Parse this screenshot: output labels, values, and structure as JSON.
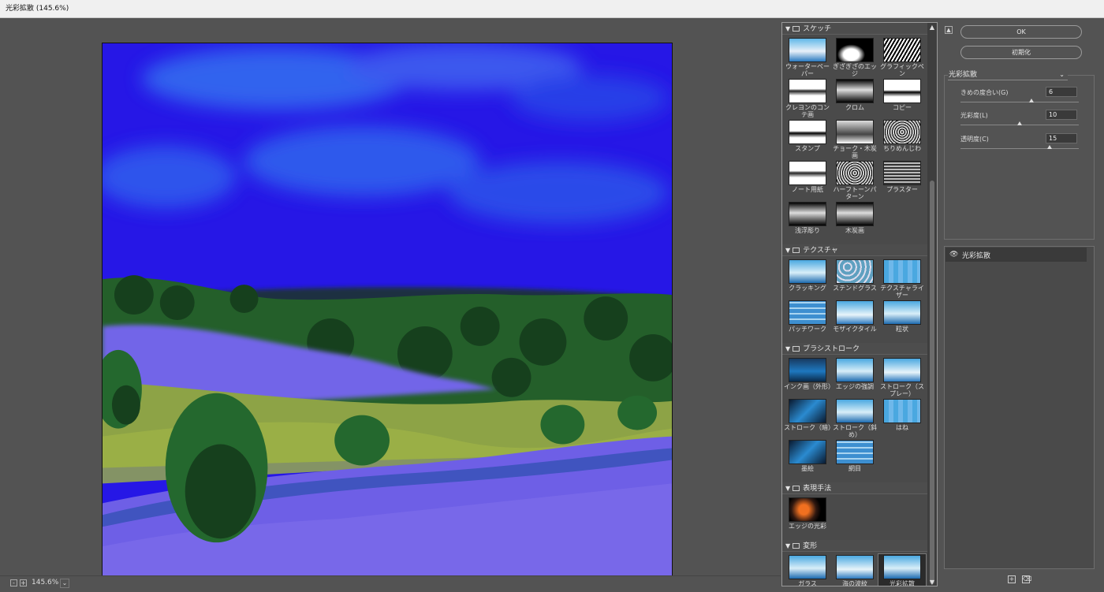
{
  "window": {
    "title": "光彩拡散 (145.6%)"
  },
  "preview": {
    "zoom": "145.6%",
    "zoom_out_label": "-",
    "zoom_in_label": "+",
    "zoom_dropdown_icon": "chevron-down-icon"
  },
  "gallery": {
    "categories": [
      {
        "name": "スケッチ",
        "filters": [
          "ウォーターペーパー",
          "ぎざぎざのエッジ",
          "グラフィックペン",
          "クレヨンのコンテ画",
          "クロム",
          "コピー",
          "スタンプ",
          "チョーク・木炭画",
          "ちりめんじわ",
          "ノート用紙",
          "ハーフトーンパターン",
          "プラスター",
          "浅浮彫り",
          "木炭画"
        ]
      },
      {
        "name": "テクスチャ",
        "filters": [
          "クラッキング",
          "ステンドグラス",
          "テクスチャライザー",
          "パッチワーク",
          "モザイクタイル",
          "粒状"
        ]
      },
      {
        "name": "ブラシストローク",
        "filters": [
          "インク画（外形）",
          "エッジの強調",
          "ストローク（スプレー）",
          "ストローク（暗）",
          "ストローク（斜め）",
          "はね",
          "墨絵",
          "網目"
        ]
      },
      {
        "name": "表現手法",
        "filters": [
          "エッジの光彩"
        ]
      },
      {
        "name": "変形",
        "filters": [
          "ガラス",
          "海の波紋",
          "光彩拡散"
        ]
      }
    ],
    "selected_filter": "光彩拡散"
  },
  "buttons": {
    "ok": "OK",
    "reset": "初期化"
  },
  "settings": {
    "filter": "光彩拡散",
    "params": [
      {
        "label": "きめの度合い(G)",
        "value": "6",
        "fraction": 0.6
      },
      {
        "label": "光彩度(L)",
        "value": "10",
        "fraction": 0.5
      },
      {
        "label": "透明度(C)",
        "value": "15",
        "fraction": 0.75
      }
    ]
  },
  "layers": {
    "items": [
      {
        "name": "光彩拡散",
        "visible": true
      }
    ]
  },
  "colors": {
    "sky": "#1f10e6",
    "lavender": "#7a66ee",
    "tree_green": "#1f6a2a",
    "grass": "#9ab040"
  }
}
